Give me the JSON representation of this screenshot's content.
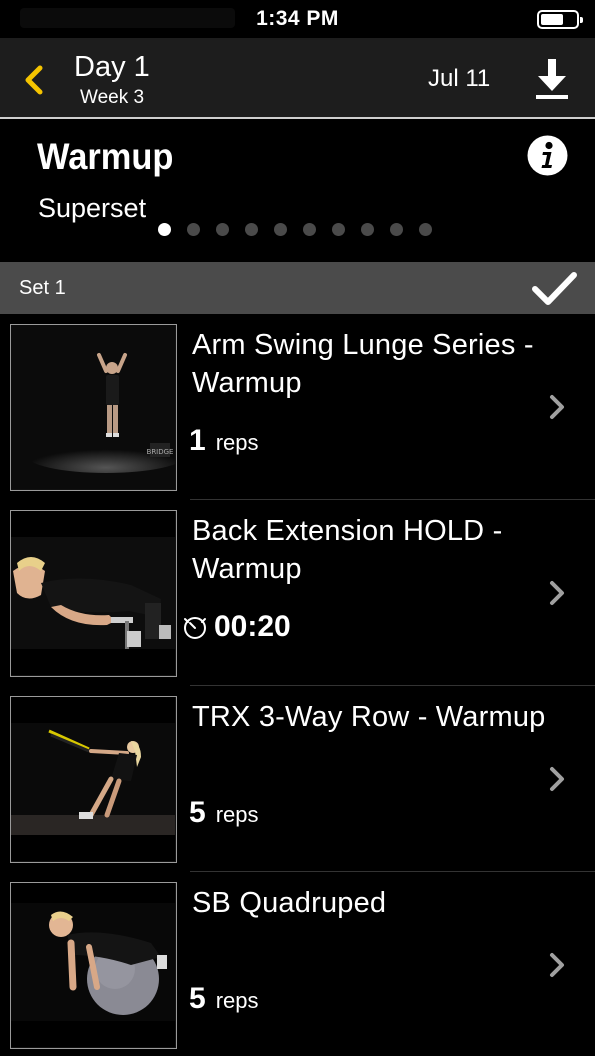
{
  "status_bar": {
    "time": "1:34 PM"
  },
  "nav": {
    "title": "Day 1",
    "subtitle": "Week 3",
    "date": "Jul 11"
  },
  "header": {
    "title": "Warmup",
    "subtitle": "Superset",
    "page_count": 10,
    "active_page": 1
  },
  "set": {
    "label": "Set 1"
  },
  "exercises": [
    {
      "name": "Arm Swing Lunge Series - Warmup",
      "count": "1",
      "unit": "reps"
    },
    {
      "name": "Back Extension HOLD - Warmup",
      "timer": "00:20"
    },
    {
      "name": "TRX 3-Way Row - Warmup",
      "count": "5",
      "unit": "reps"
    },
    {
      "name": "SB Quadruped",
      "count": "5",
      "unit": "reps"
    }
  ],
  "thumb_logo": "BRIDGE",
  "colors": {
    "accent": "#f5c400",
    "nav_bg": "#1d1d1d",
    "set_bar_bg": "#4b4b4b",
    "chevron": "#a0a0a0"
  },
  "icons": {
    "back": "chevron-left-icon",
    "download": "download-icon",
    "info": "info-icon",
    "check": "checkmark-icon",
    "row": "chevron-right-icon",
    "timer": "stopwatch-icon"
  }
}
